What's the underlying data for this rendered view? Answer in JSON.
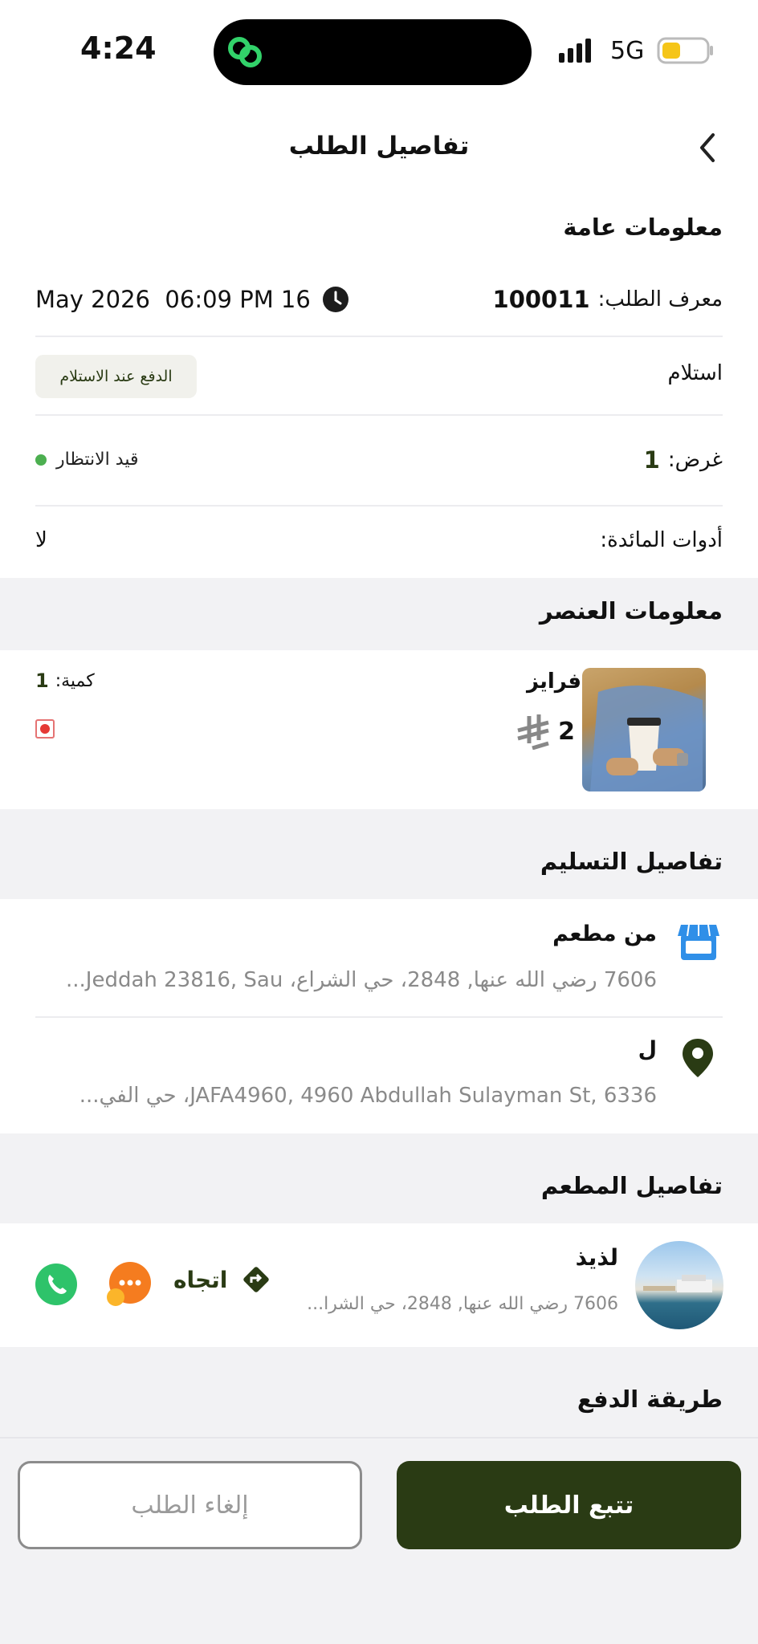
{
  "status_bar": {
    "time": "4:24",
    "network": "5G"
  },
  "header": {
    "title": "تفاصيل الطلب"
  },
  "general": {
    "section_title": "معلومات عامة",
    "order_id_label": "معرف الطلب:",
    "order_id_value": "100011",
    "datetime": "May 2026  06:09 PM 16",
    "delivery_type": "استلام",
    "payment_badge": "الدفع عند الاستلام",
    "purpose_label": "غرض:",
    "purpose_value": "1",
    "status_text": "قيد الانتظار",
    "cutlery_label": "أدوات المائدة:",
    "cutlery_value": "لا"
  },
  "item_info": {
    "section_title": "معلومات العنصر",
    "item_name": "فرايز",
    "price": "2",
    "quantity_label": "كمية:",
    "quantity_value": "1"
  },
  "delivery": {
    "section_title": "تفاصيل التسليم",
    "from_title": "من مطعم",
    "from_address": "7606 رضي الله عنها, 2848، حي الشراع، Jeddah 23816, Sau...",
    "to_title": "ل",
    "to_address": "JAFA4960, 4960 Abdullah Sulayman St, 6336، حي الفي..."
  },
  "restaurant": {
    "section_title": "تفاصيل المطعم",
    "name": "لذيذ",
    "address": "7606 رضي الله عنها, 2848، حي الشرا...",
    "direction_label": "اتجاه"
  },
  "payment": {
    "section_title": "طريقة الدفع"
  },
  "actions": {
    "track_label": "تتبع الطلب",
    "cancel_label": "إلغاء الطلب"
  },
  "colors": {
    "primary": "#2a3b14",
    "accent_green": "#4caf50",
    "store_blue": "#2f8fe8",
    "chat_orange": "#f57c1f",
    "call_green": "#2ec36a",
    "veg_red": "#e53935"
  }
}
